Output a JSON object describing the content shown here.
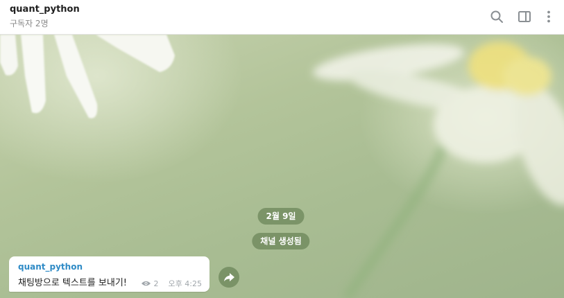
{
  "header": {
    "title": "quant_python",
    "subtitle": "구독자 2명",
    "icons": [
      "search-icon",
      "sidebar-toggle-icon",
      "more-vertical-icon"
    ]
  },
  "chat": {
    "date_label": "2월 9일",
    "service_message": "채널 생성됨",
    "message": {
      "sender": "quant_python",
      "text": "채팅방으로 텍스트를 보내기!",
      "views": "2",
      "time": "오후 4:25"
    }
  },
  "colors": {
    "sender_name": "#2f8bc6",
    "pill_background": "#607a4e",
    "wallpaper_green": "#b3c49a",
    "icon_gray": "#8a8f93"
  }
}
